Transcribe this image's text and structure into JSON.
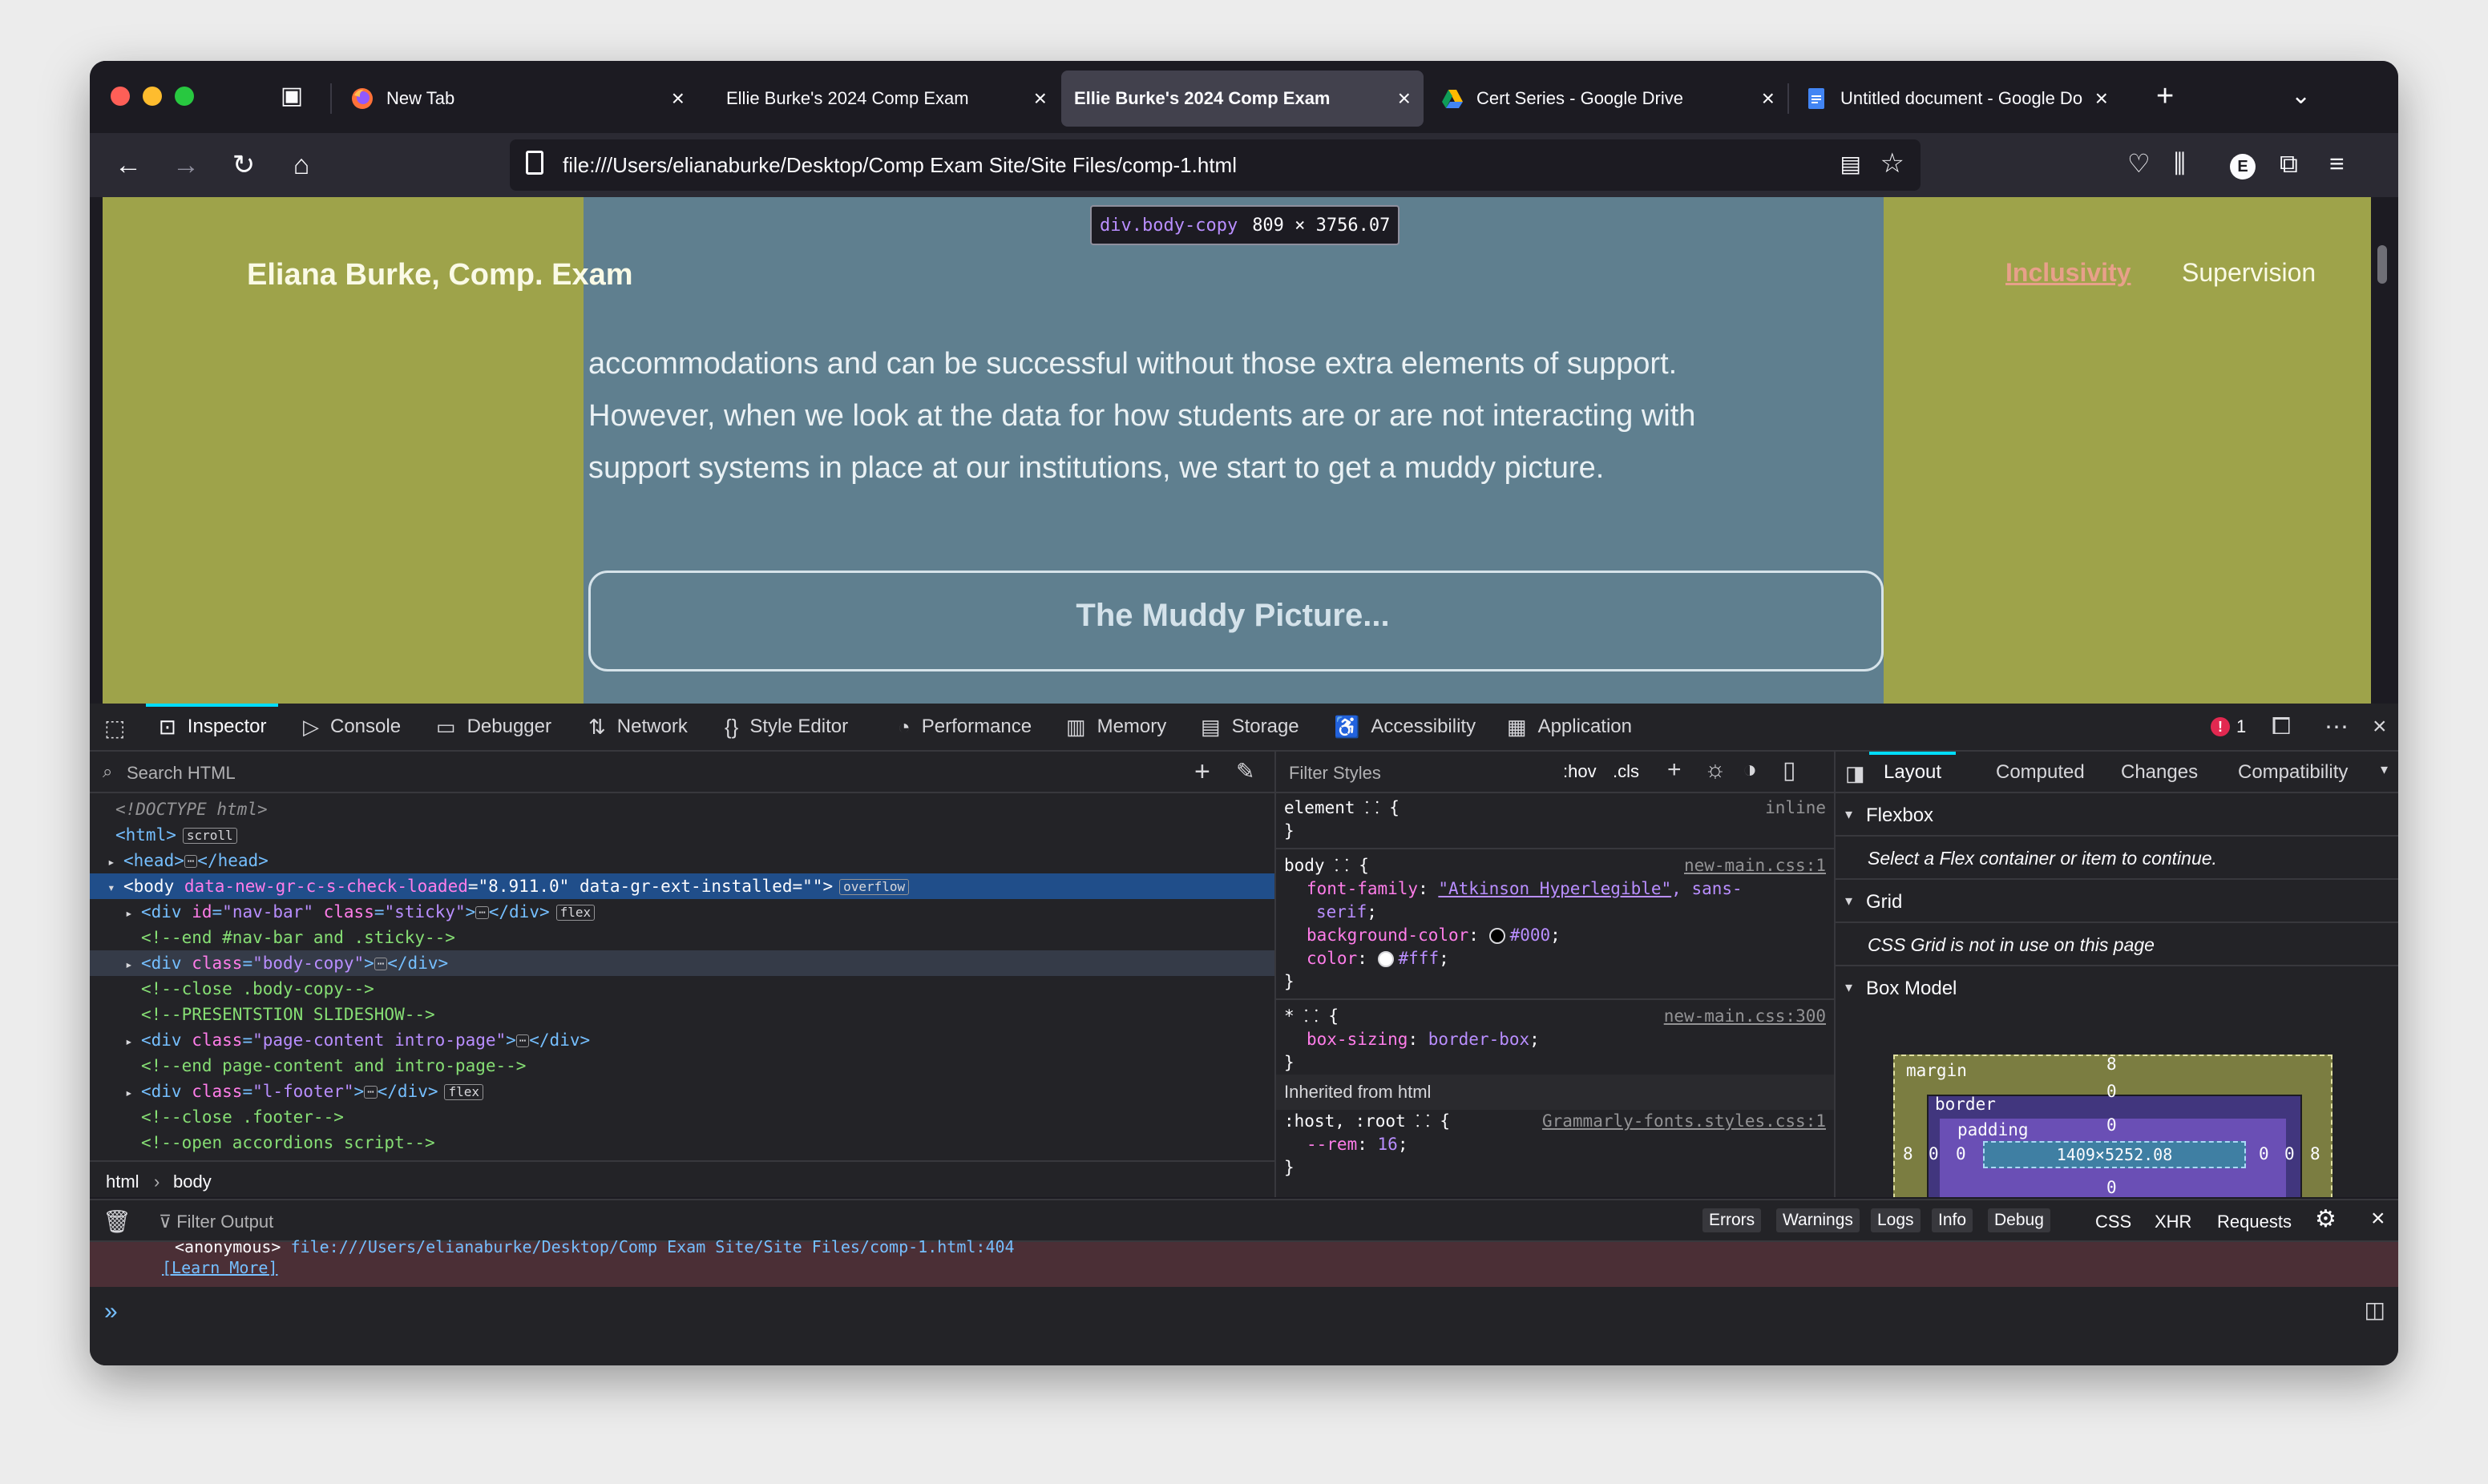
{
  "browser": {
    "tabs": [
      {
        "title": "New Tab",
        "favicon": "firefox-icon",
        "active": false
      },
      {
        "title": "Ellie Burke's 2024 Comp Exam",
        "favicon": "none",
        "active": false
      },
      {
        "title": "Ellie Burke's 2024 Comp Exam",
        "favicon": "none",
        "active": true
      },
      {
        "title": "Cert Series - Google Drive",
        "favicon": "google-drive-icon",
        "active": false
      },
      {
        "title": "Untitled document - Google Do",
        "favicon": "google-docs-icon",
        "active": false
      }
    ],
    "url": "file:///Users/elianaburke/Desktop/Comp Exam Site/Site Files/comp-1.html",
    "account_initial": "E"
  },
  "page": {
    "site_title": "Eliana Burke, Comp. Exam",
    "nav": {
      "inclusivity": "Inclusivity",
      "supervision": "Supervision"
    },
    "highlight_tooltip": {
      "selector": "div.body-copy",
      "size": "809 × 3756.07"
    },
    "paragraph_lines": [
      "accommodations and can be successful without those extra elements of support.",
      "However, when we look at the data for how students are or are not interacting with",
      "support systems in place at our institutions, we start to get a muddy picture."
    ],
    "muddy_button": "The Muddy Picture..."
  },
  "devtools": {
    "tabs": [
      "Inspector",
      "Console",
      "Debugger",
      "Network",
      "Style Editor",
      "Performance",
      "Memory",
      "Storage",
      "Accessibility",
      "Application"
    ],
    "error_count": "1",
    "search_placeholder": "Search HTML",
    "markup": {
      "doctype": "<!DOCTYPE html>",
      "html_tag": "<html>",
      "html_badge": "scroll",
      "head": "<head>",
      "head_close": "</head>",
      "body_attr1_name": "data-new-gr-c-s-check-loaded",
      "body_attr1_val": "\"8.911.0\"",
      "body_attr2_name": "data-gr-ext-installed",
      "body_attr2_val": "\"\"",
      "body_badge": "overflow",
      "navbar_id": "\"nav-bar\"",
      "navbar_class": "\"sticky\"",
      "flex_badge": "flex",
      "c_end_nav": "<!--end #nav-bar and .sticky-->",
      "bodycopy_class": "\"body-copy\"",
      "c_close_bodycopy": "<!--close .body-copy-->",
      "c_slideshow": "<!--PRESENTSTION SLIDESHOW-->",
      "pagecontent_class": "\"page-content intro-page\"",
      "c_end_page": "<!--end page-content and intro-page-->",
      "footer_class": "\"l-footer\"",
      "c_close_footer": "<!--close .footer-->",
      "c_accordions": "<!--open accordions script-->"
    },
    "breadcrumbs": [
      "html",
      "body"
    ],
    "rules": {
      "filter_placeholder": "Filter Styles",
      "hov": ":hov",
      "cls": ".cls",
      "element_selector": "element",
      "element_src": "inline",
      "body_selector": "body",
      "body_src": "new-main.css:1",
      "font_family_prop": "font-family",
      "font_family_val1": "\"Atkinson Hyperlegible\"",
      "font_family_val2": ", sans-",
      "font_family_val3": "serif",
      "bg_prop": "background-color",
      "bg_val": "#000",
      "color_prop": "color",
      "color_val": "#fff",
      "star_selector": "*",
      "star_src": "new-main.css:300",
      "boxsizing_prop": "box-sizing",
      "boxsizing_val": "border-box",
      "inherited": "Inherited from html",
      "host_selector": ":host, :root",
      "host_src": "Grammarly-fonts.styles.css:1",
      "rem_prop": "--rem",
      "rem_val": "16"
    },
    "layout_panel": {
      "tabs": [
        "Layout",
        "Computed",
        "Changes",
        "Compatibility"
      ],
      "flexbox_title": "Flexbox",
      "flexbox_note": "Select a Flex container or item to continue.",
      "grid_title": "Grid",
      "grid_note": "CSS Grid is not in use on this page",
      "boxmodel_title": "Box Model",
      "box": {
        "margin_label": "margin",
        "border_label": "border",
        "padding_label": "padding",
        "content": "1409×5252.08",
        "margin": "8",
        "border": "0",
        "padding": "0"
      }
    },
    "console": {
      "filter_placeholder": "Filter Output",
      "filters": [
        "Errors",
        "Warnings",
        "Logs",
        "Info",
        "Debug"
      ],
      "links": [
        "CSS",
        "XHR",
        "Requests"
      ],
      "error_frame": "<anonymous>",
      "error_link": "file:///Users/elianaburke/Desktop/Comp Exam Site/Site Files/comp-1.html:404",
      "learn_more": "[Learn More]"
    }
  },
  "colors": {
    "page_bg": "#9ea34a",
    "body_copy_bg": "#5f7f8f",
    "accent": "#00ddff"
  }
}
